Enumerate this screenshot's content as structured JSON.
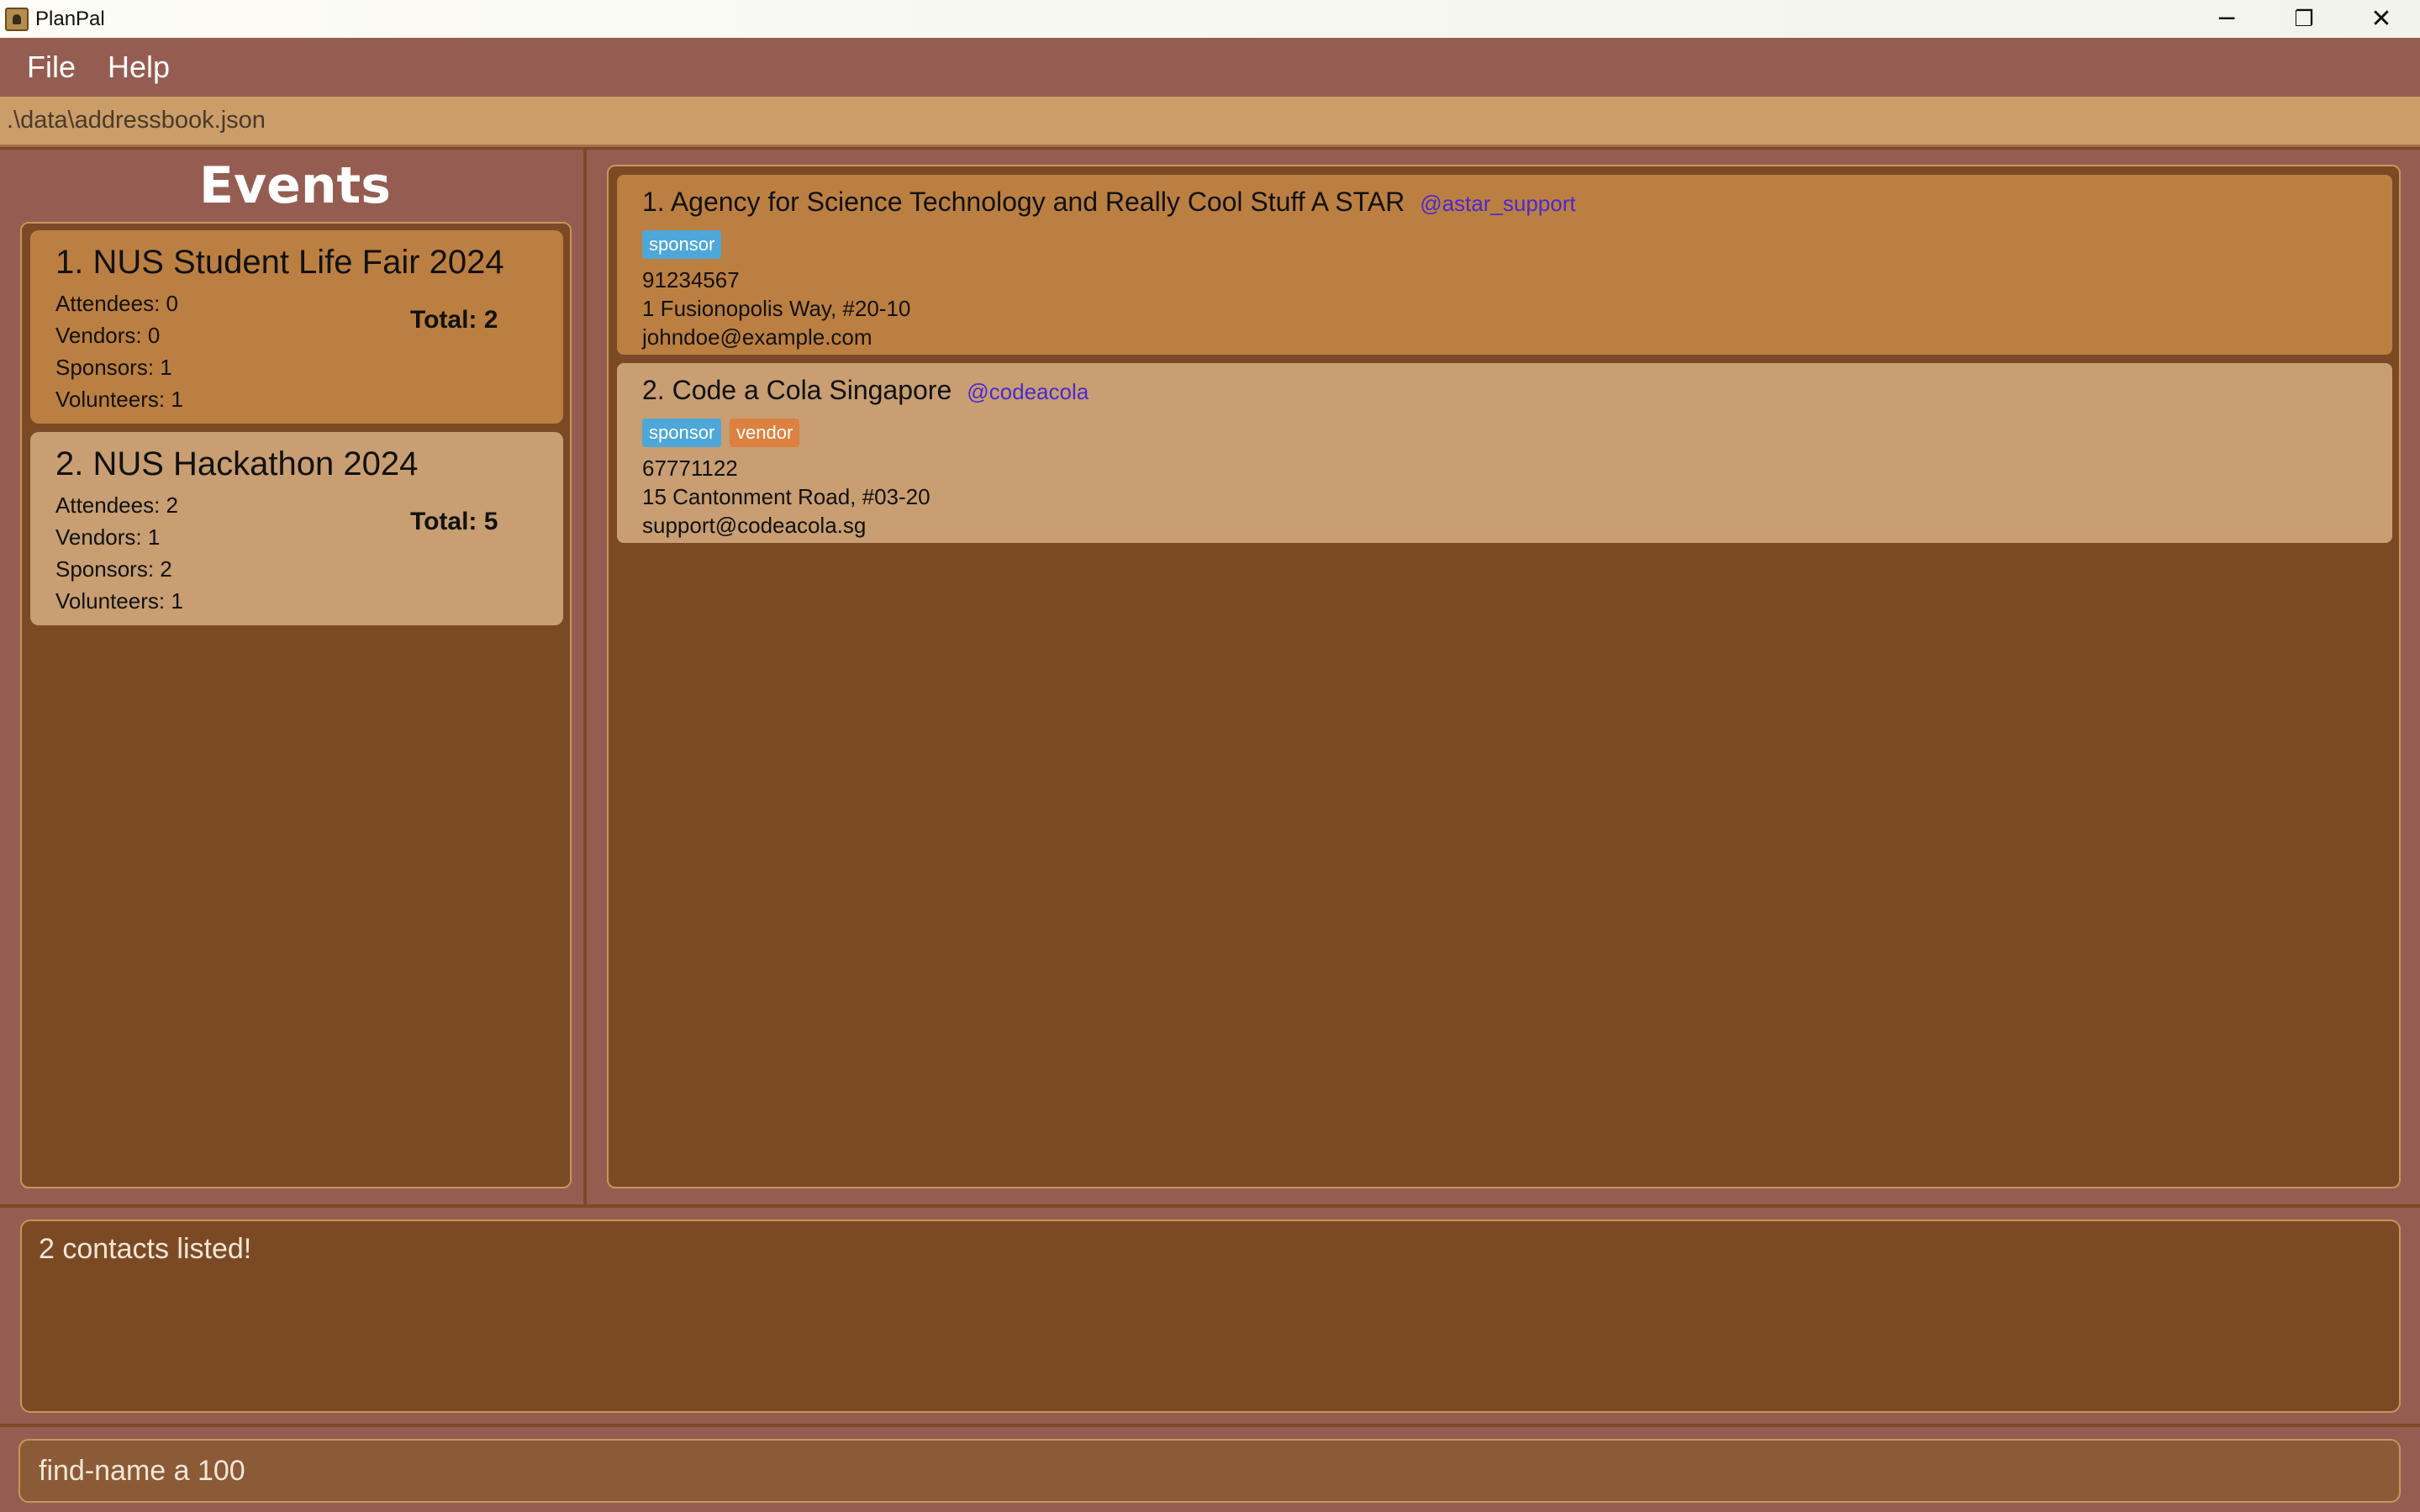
{
  "window": {
    "title": "PlanPal",
    "controls": {
      "minimize": "─",
      "restore": "❐",
      "close": "✕"
    }
  },
  "menu": {
    "items": [
      "File",
      "Help"
    ]
  },
  "file_path": ".\\data\\addressbook.json",
  "events": {
    "title": "Events",
    "items": [
      {
        "name": "1. NUS Student Life Fair 2024",
        "attendees": "Attendees: 0",
        "vendors": "Vendors: 0",
        "sponsors": "Sponsors: 1",
        "volunteers": "Volunteers: 1",
        "total": "Total: 2",
        "selected": true
      },
      {
        "name": "2. NUS Hackathon 2024",
        "attendees": "Attendees: 2",
        "vendors": "Vendors: 1",
        "sponsors": "Sponsors: 2",
        "volunteers": "Volunteers: 1",
        "total": "Total: 5",
        "selected": false
      }
    ]
  },
  "contacts": {
    "items": [
      {
        "name": "1. Agency for Science Technology and Really Cool Stuff A STAR",
        "handle": "@astar_support",
        "tags": [
          "sponsor"
        ],
        "phone": "91234567",
        "address": "1 Fusionopolis Way, #20-10",
        "email": "johndoe@example.com",
        "selected": true
      },
      {
        "name": "2. Code a Cola Singapore",
        "handle": "@codeacola",
        "tags": [
          "sponsor",
          "vendor"
        ],
        "phone": "67771122",
        "address": "15 Cantonment Road, #03-20",
        "email": "support@codeacola.sg",
        "selected": false
      }
    ]
  },
  "result": {
    "text": "2 contacts listed!"
  },
  "command": {
    "value": "find-name a 100"
  },
  "colors": {
    "menubar": "#955d51",
    "pathbar": "#cb9d69",
    "panel_bg": "#7b4a25",
    "card_selected": "#bc7f42",
    "card_normal": "#c89e72",
    "tag_sponsor": "#4ea7d9",
    "tag_vendor": "#dc8140",
    "handle": "#4a2ad0"
  },
  "icons": {
    "app": "planpal-app-icon"
  }
}
